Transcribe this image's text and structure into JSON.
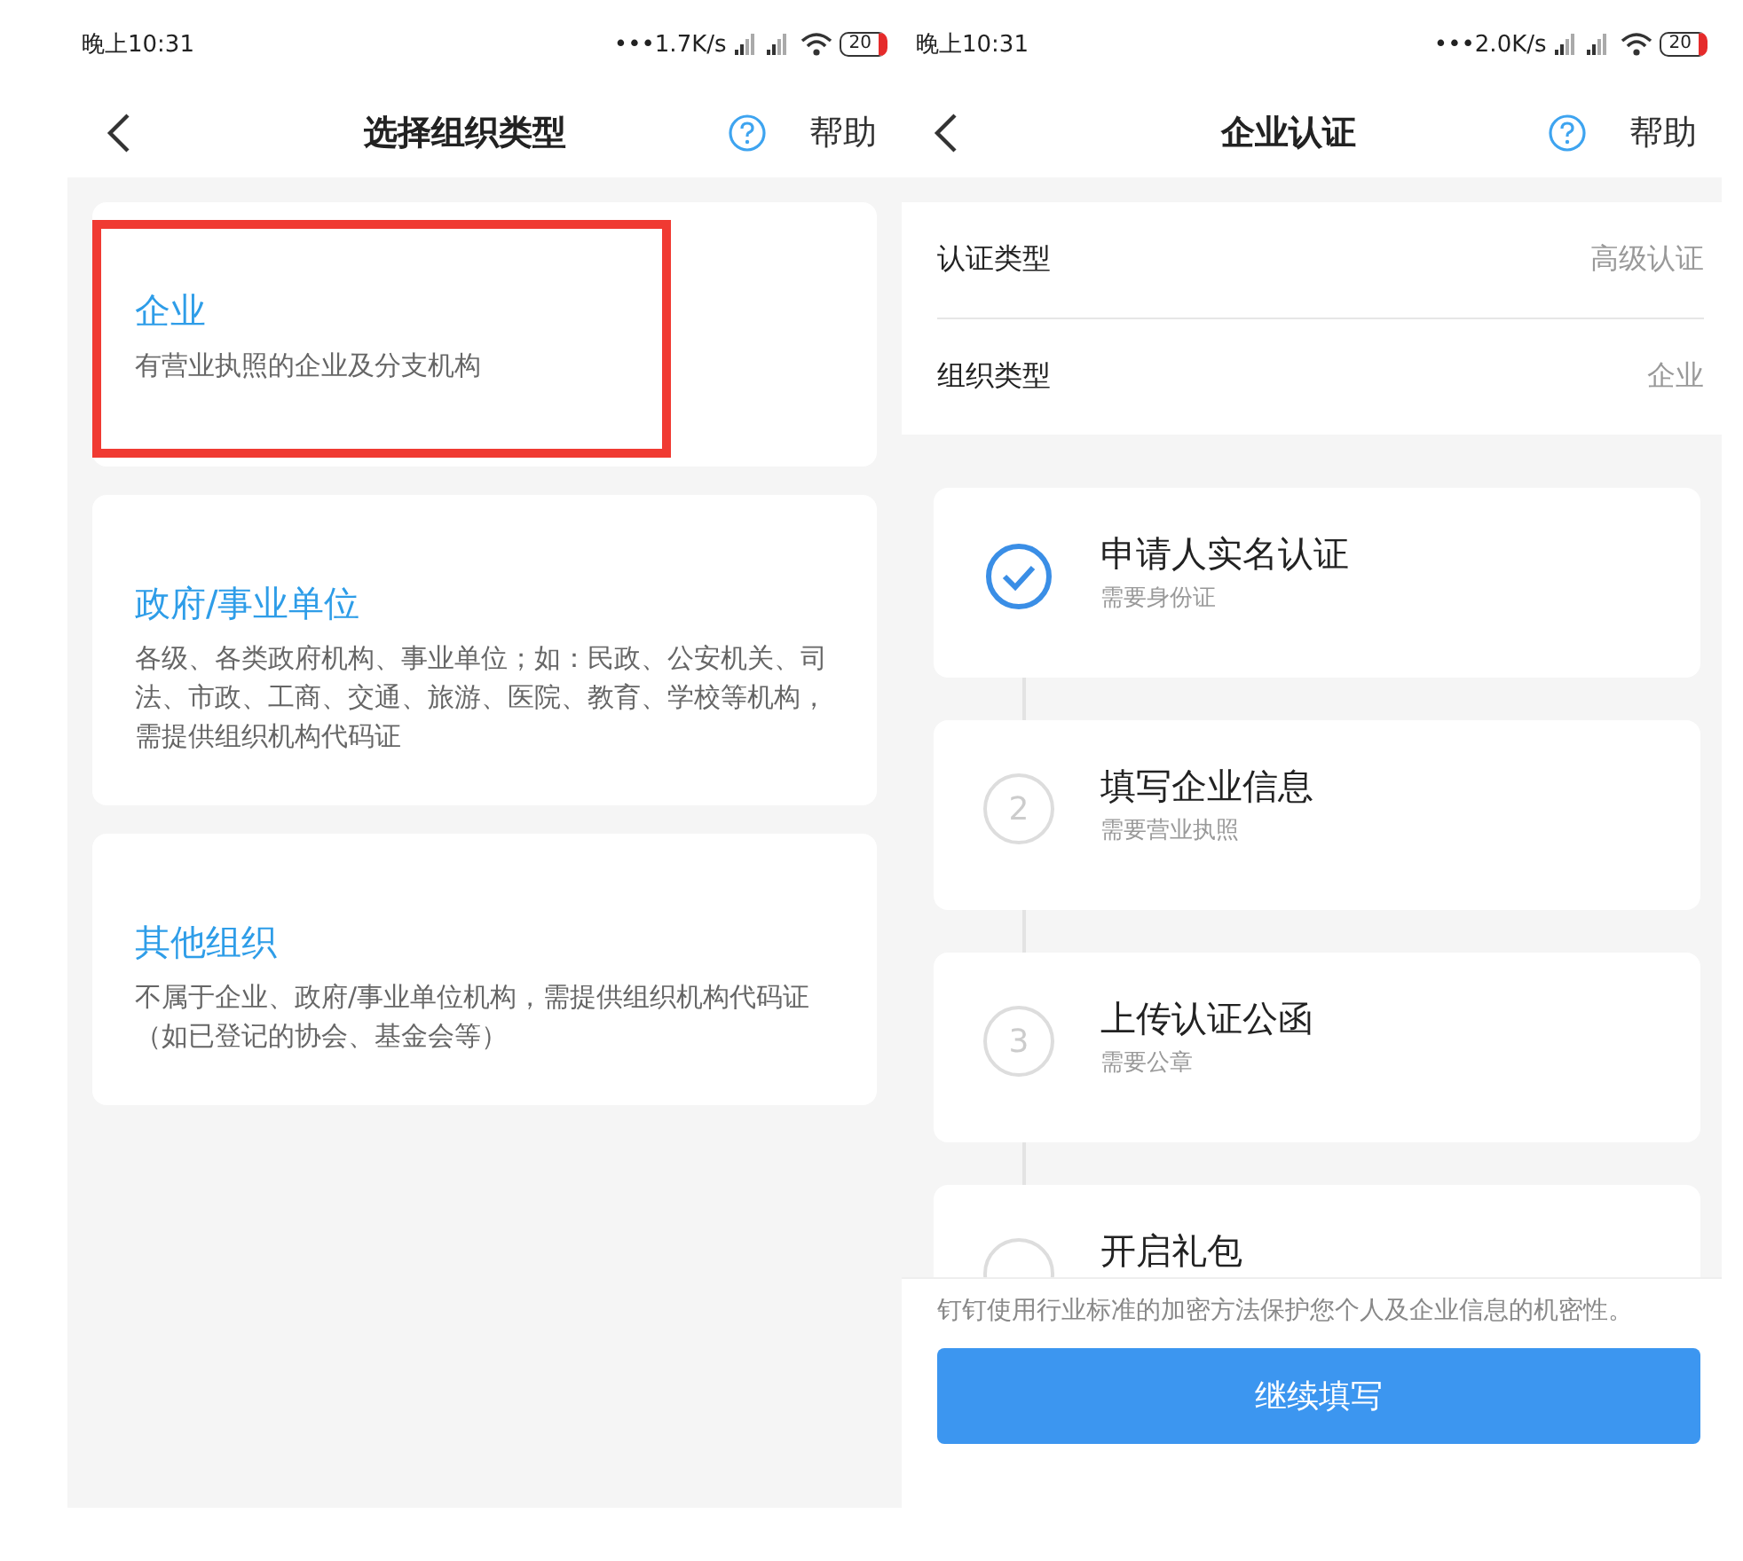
{
  "screens": [
    {
      "status_bar": {
        "time": "晚上10:31",
        "speed": "•••1.7K/s",
        "battery": "20"
      },
      "header": {
        "title": "选择组织类型",
        "help": "帮助"
      },
      "org_types": [
        {
          "title": "企业",
          "description": "有营业执照的企业及分支机构",
          "highlighted": true
        },
        {
          "title": "政府/事业单位",
          "description": "各级、各类政府机构、事业单位；如：民政、公安机关、司法、市政、工商、交通、旅游、医院、教育、学校等机构，需提供组织机构代码证",
          "highlighted": false
        },
        {
          "title": "其他组织",
          "description": "不属于企业、政府/事业单位机构，需提供组织机构代码证（如已登记的协会、基金会等）",
          "highlighted": false
        }
      ]
    },
    {
      "status_bar": {
        "time": "晚上10:31",
        "speed": "•••2.0K/s",
        "battery": "20"
      },
      "header": {
        "title": "企业认证",
        "help": "帮助"
      },
      "info_rows": [
        {
          "label": "认证类型",
          "value": "高级认证"
        },
        {
          "label": "组织类型",
          "value": "企业"
        }
      ],
      "steps": [
        {
          "title": "申请人实名认证",
          "requirement": "需要身份证",
          "done": true
        },
        {
          "title": "填写企业信息",
          "requirement": "需要营业执照",
          "number": "2",
          "done": false
        },
        {
          "title": "上传认证公函",
          "requirement": "需要公章",
          "number": "3",
          "done": false
        },
        {
          "title": "开启礼包",
          "done": false
        }
      ],
      "notice": "钉钉使用行业标准的加密方法保护您个人及企业信息的机密性。",
      "button": "继续填写"
    }
  ]
}
